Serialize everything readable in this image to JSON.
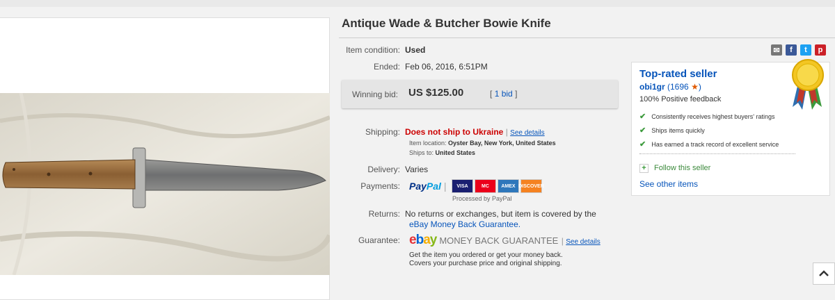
{
  "listing": {
    "title": "Antique Wade & Butcher Bowie Knife"
  },
  "details": {
    "condition_label": "Item condition:",
    "condition_value": "Used",
    "ended_label": "Ended:",
    "ended_value": "Feb 06, 2016, 6:51PM",
    "bid_label": "Winning bid:",
    "bid_value": "US $125.00",
    "bid_count_open": "[",
    "bid_count": "1 bid",
    "bid_count_close": "]",
    "shipping_label": "Shipping:",
    "shipping_value": "Does not ship to Ukraine",
    "see_details": "See details",
    "location_label": "Item location:",
    "location_value": "Oyster Bay, New York, United States",
    "ships_to_label": "Ships to:",
    "ships_to_value": "United States",
    "delivery_label": "Delivery:",
    "delivery_value": "Varies",
    "payments_label": "Payments:",
    "paypal_a": "Pay",
    "paypal_b": "Pal",
    "processed_by": "Processed by PayPal",
    "returns_label": "Returns:",
    "returns_text": "No returns or exchanges, but item is covered by the",
    "returns_link": "eBay Money Back Guarantee.",
    "guarantee_label": "Guarantee:",
    "guarantee_brand": "MONEY BACK GUARANTEE",
    "guarantee_see_details": "See details",
    "guarantee_line1": "Get the item you ordered or get your money back.",
    "guarantee_line2": "Covers your purchase price and original shipping."
  },
  "cards": [
    {
      "name": "VISA",
      "bg": "#1a1f71"
    },
    {
      "name": "MC",
      "bg": "#eb001b"
    },
    {
      "name": "AMEX",
      "bg": "#2e77bb"
    },
    {
      "name": "DISCOVER",
      "bg": "#f58220"
    }
  ],
  "seller": {
    "heading": "Top-rated seller",
    "name": "obi1gr",
    "feedback_count": "(1696",
    "feedback_close": ")",
    "positive": "100% Positive feedback",
    "bullets": [
      "Consistently receives highest buyers' ratings",
      "Ships items quickly",
      "Has earned a track record of excellent service"
    ],
    "follow": "Follow this seller",
    "see_other": "See other items"
  },
  "colors": {
    "link": "#0654ba",
    "alert_red": "#cc0000",
    "check_green": "#3c9a3c"
  }
}
